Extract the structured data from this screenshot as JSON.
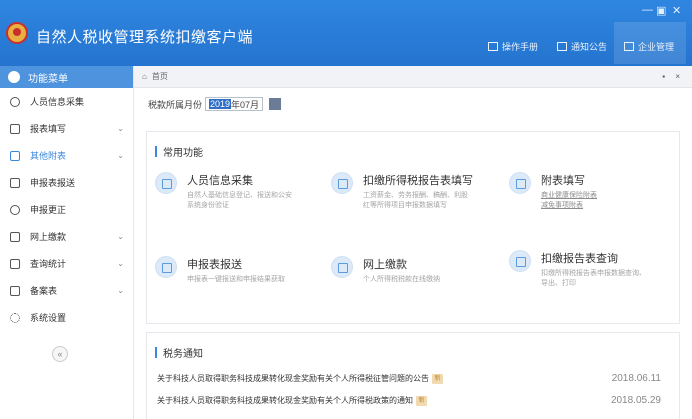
{
  "window": {
    "title": "自然人税收管理系统扣缴客户端",
    "controls": [
      "—",
      "▣",
      "✕"
    ]
  },
  "topnav": [
    {
      "label": "操作手册",
      "icon": "manual-icon"
    },
    {
      "label": "通知公告",
      "icon": "mail-icon"
    },
    {
      "label": "企业管理",
      "icon": "building-icon"
    }
  ],
  "sidebar": {
    "header": "功能菜单",
    "items": [
      {
        "label": "人员信息采集",
        "icon": "user-icon",
        "has_chevron": false
      },
      {
        "label": "报表填写",
        "icon": "edit-icon",
        "has_chevron": true
      },
      {
        "label": "其他附表",
        "icon": "grid-icon",
        "has_chevron": true,
        "active": true
      },
      {
        "label": "申报表报送",
        "icon": "send-icon",
        "has_chevron": false
      },
      {
        "label": "申报更正",
        "icon": "search-icon",
        "has_chevron": false
      },
      {
        "label": "网上缴款",
        "icon": "wallet-icon",
        "has_chevron": true
      },
      {
        "label": "查询统计",
        "icon": "stats-icon",
        "has_chevron": true
      },
      {
        "label": "备案表",
        "icon": "document-icon",
        "has_chevron": true
      },
      {
        "label": "系统设置",
        "icon": "gear-icon",
        "has_chevron": false
      }
    ],
    "collapse": "«"
  },
  "breadcrumb": {
    "home": "首页",
    "tools": "▪ ×"
  },
  "period": {
    "label": "税款所属月份",
    "year": "2019",
    "month": "年07月"
  },
  "common_functions": {
    "title": "常用功能",
    "cards": [
      {
        "title": "人员信息采集",
        "desc": [
          "自然人基础信息登记、报送和公安",
          "系统身份验证"
        ],
        "icon": "id-card-icon"
      },
      {
        "title": "扣缴所得税报告表填写",
        "desc": [
          "工资薪金、劳务报酬、稿酬、利股",
          "红等所得项目申报数据填写"
        ],
        "icon": "form-icon"
      },
      {
        "title": "附表填写",
        "desc": [
          "商业健康保险附表",
          "减免事项附表"
        ],
        "icon": "edit-icon",
        "link": true
      },
      {
        "title": "申报表报送",
        "desc": [
          "申报表一键报送和申报结果获取"
        ],
        "icon": "send-form-icon"
      },
      {
        "title": "网上缴款",
        "desc": [
          "个人所得税税款在线缴纳"
        ],
        "icon": "payment-icon"
      },
      {
        "title": "扣缴报告表查询",
        "desc": [
          "扣缴所得税报告表申报数据查询、",
          "导出、打印"
        ],
        "icon": "query-icon"
      }
    ]
  },
  "tax_notice": {
    "title": "税务通知",
    "items": [
      {
        "text": "关于科技人员取得职务科技成果转化现金奖励有关个人所得税征管问题的公告",
        "badge": "新",
        "date": "2018.06.11"
      },
      {
        "text": "关于科技人员取得职务科技成果转化现金奖励有关个人所得税政策的通知",
        "badge": "新",
        "date": "2018.05.29"
      }
    ]
  }
}
